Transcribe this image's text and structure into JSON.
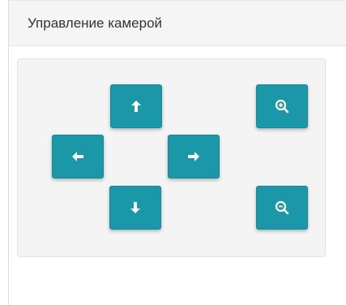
{
  "panel": {
    "title": "Управление камерой"
  },
  "controls": {
    "up": {
      "icon": "arrow-up-icon"
    },
    "left": {
      "icon": "arrow-left-icon"
    },
    "right": {
      "icon": "arrow-right-icon"
    },
    "down": {
      "icon": "arrow-down-icon"
    },
    "zoom_in": {
      "icon": "zoom-in-icon"
    },
    "zoom_out": {
      "icon": "zoom-out-icon"
    }
  },
  "colors": {
    "button": "#1b98a7",
    "icon": "#ffffff",
    "header_bg": "#f5f5f5",
    "well_bg": "#f4f4f4"
  }
}
